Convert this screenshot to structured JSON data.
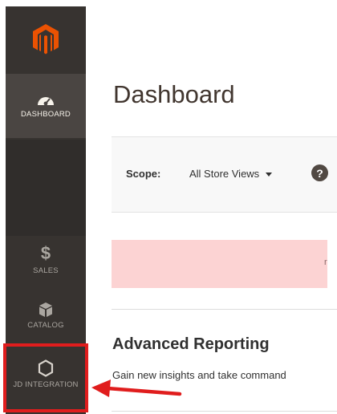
{
  "sidebar": {
    "items": [
      {
        "label": "DASHBOARD",
        "icon": "speedometer-icon",
        "active": true
      },
      {
        "label": "SALES",
        "icon": "dollar-icon"
      },
      {
        "label": "CATALOG",
        "icon": "box-icon"
      },
      {
        "label": "JD INTEGRATION",
        "icon": "hexagon-icon"
      }
    ]
  },
  "header": {
    "title": "Dashboard"
  },
  "scope": {
    "label": "Scope:",
    "value": "All Store Views",
    "help_icon": "?"
  },
  "message": {
    "text": "r."
  },
  "advanced_reporting": {
    "title": "Advanced Reporting",
    "description": "Gain new insights and take command"
  },
  "colors": {
    "sidebar_bg": "#373330",
    "sidebar_active_bg": "#4a4542",
    "logo_orange": "#eb5202",
    "highlight_red": "#e01d1d",
    "message_bg": "#fcd3d3"
  }
}
